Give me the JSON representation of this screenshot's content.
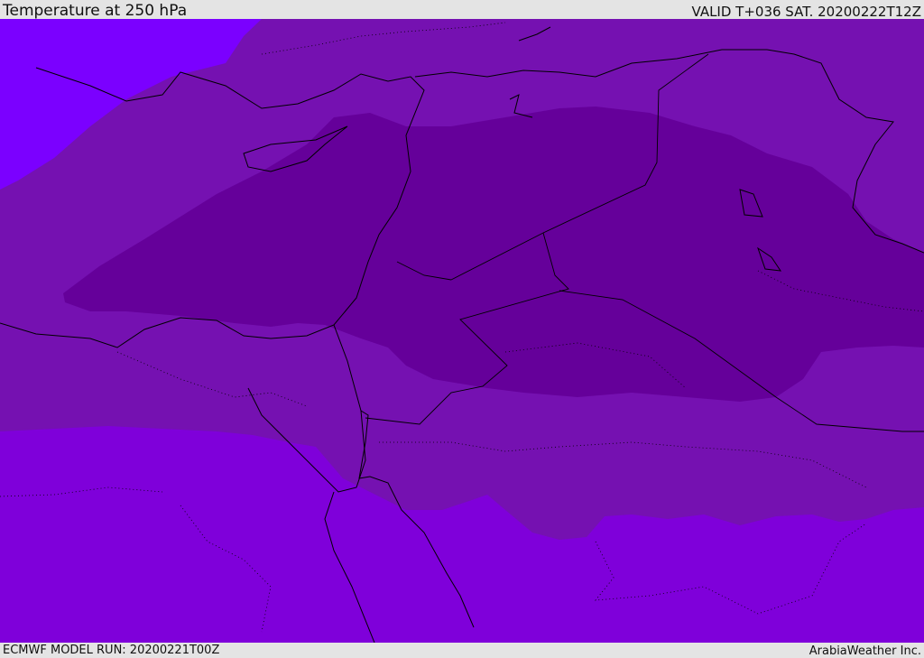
{
  "header": {
    "title": "Temperature at 250 hPa",
    "valid": "VALID T+036 SAT. 20200222T12Z"
  },
  "footer": {
    "model_run": "ECMWF MODEL RUN: 20200221T00Z",
    "credit": "ArabiaWeather Inc."
  },
  "map": {
    "colors": {
      "warm_band": "#7f00da",
      "mid_band": "#7511b1",
      "cold_core": "#65009a",
      "northwest_band": "#7b00ff",
      "coastline": "#000000"
    }
  }
}
